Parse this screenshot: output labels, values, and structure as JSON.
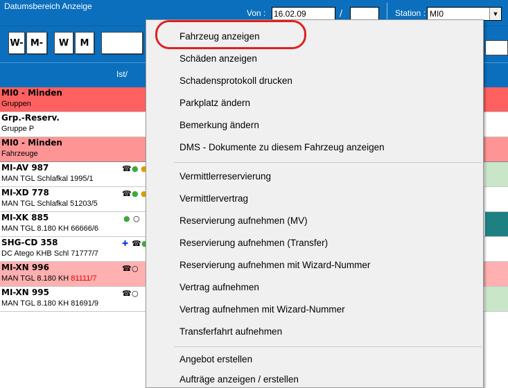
{
  "header": {
    "title": "Datumsbereich Anzeige",
    "von_label": "Von :",
    "von_value": "16.02.09",
    "slash": "/",
    "bis_value": "",
    "station_label": "Station :",
    "station_value": "MI0"
  },
  "buttons": {
    "w_minus": "W-",
    "m_minus": "M-",
    "w": "W",
    "m": "M"
  },
  "column_header": "Ist/",
  "rows": [
    {
      "line1": "MI0 - Minden",
      "line2": "Gruppen"
    },
    {
      "line1": "Grp.-Reserv.",
      "line2": "Gruppe P"
    },
    {
      "line1": "MI0 - Minden",
      "line2": "Fahrzeuge"
    },
    {
      "line1": "MI-AV 987",
      "line2": "MAN TGL Schlafkal  1995/1"
    },
    {
      "line1": "MI-XD 778",
      "line2": "MAN TGL Schlafkal 51203/5"
    },
    {
      "line1": "MI-XK 885",
      "line2": "MAN TGL 8.180 KH 66666/6"
    },
    {
      "line1": "SHG-CD 358",
      "line2": "DC Atego KHB Schl 71777/7"
    },
    {
      "line1": "MI-XN 996",
      "line2a": "MAN TGL 8.180 KH ",
      "line2b": "81111/7"
    },
    {
      "line1": "MI-XN 995",
      "line2": "MAN TGL 8.180 KH 81691/9"
    }
  ],
  "menu": {
    "items": [
      "Fahrzeug anzeigen",
      "Schäden anzeigen",
      "Schadensprotokoll drucken",
      "Parkplatz ändern",
      "Bemerkung ändern",
      "DMS - Dokumente zu diesem Fahrzeug anzeigen",
      "Vermittlerreservierung",
      "Vermittlervertrag",
      "Reservierung aufnehmen (MV)",
      "Reservierung aufnehmen (Transfer)",
      "Reservierung aufnehmen mit Wizard-Nummer",
      "Vertrag aufnehmen",
      "Vertrag aufnehmen mit Wizard-Nummer",
      "Transferfahrt aufnehmen",
      "Angebot erstellen",
      "Aufträge anzeigen / erstellen"
    ]
  },
  "colors": {
    "header_blue": "#0b6fbd",
    "row_red": "#ff6060",
    "row_pink": "#ff9494",
    "highlight_circle": "#e02020"
  }
}
